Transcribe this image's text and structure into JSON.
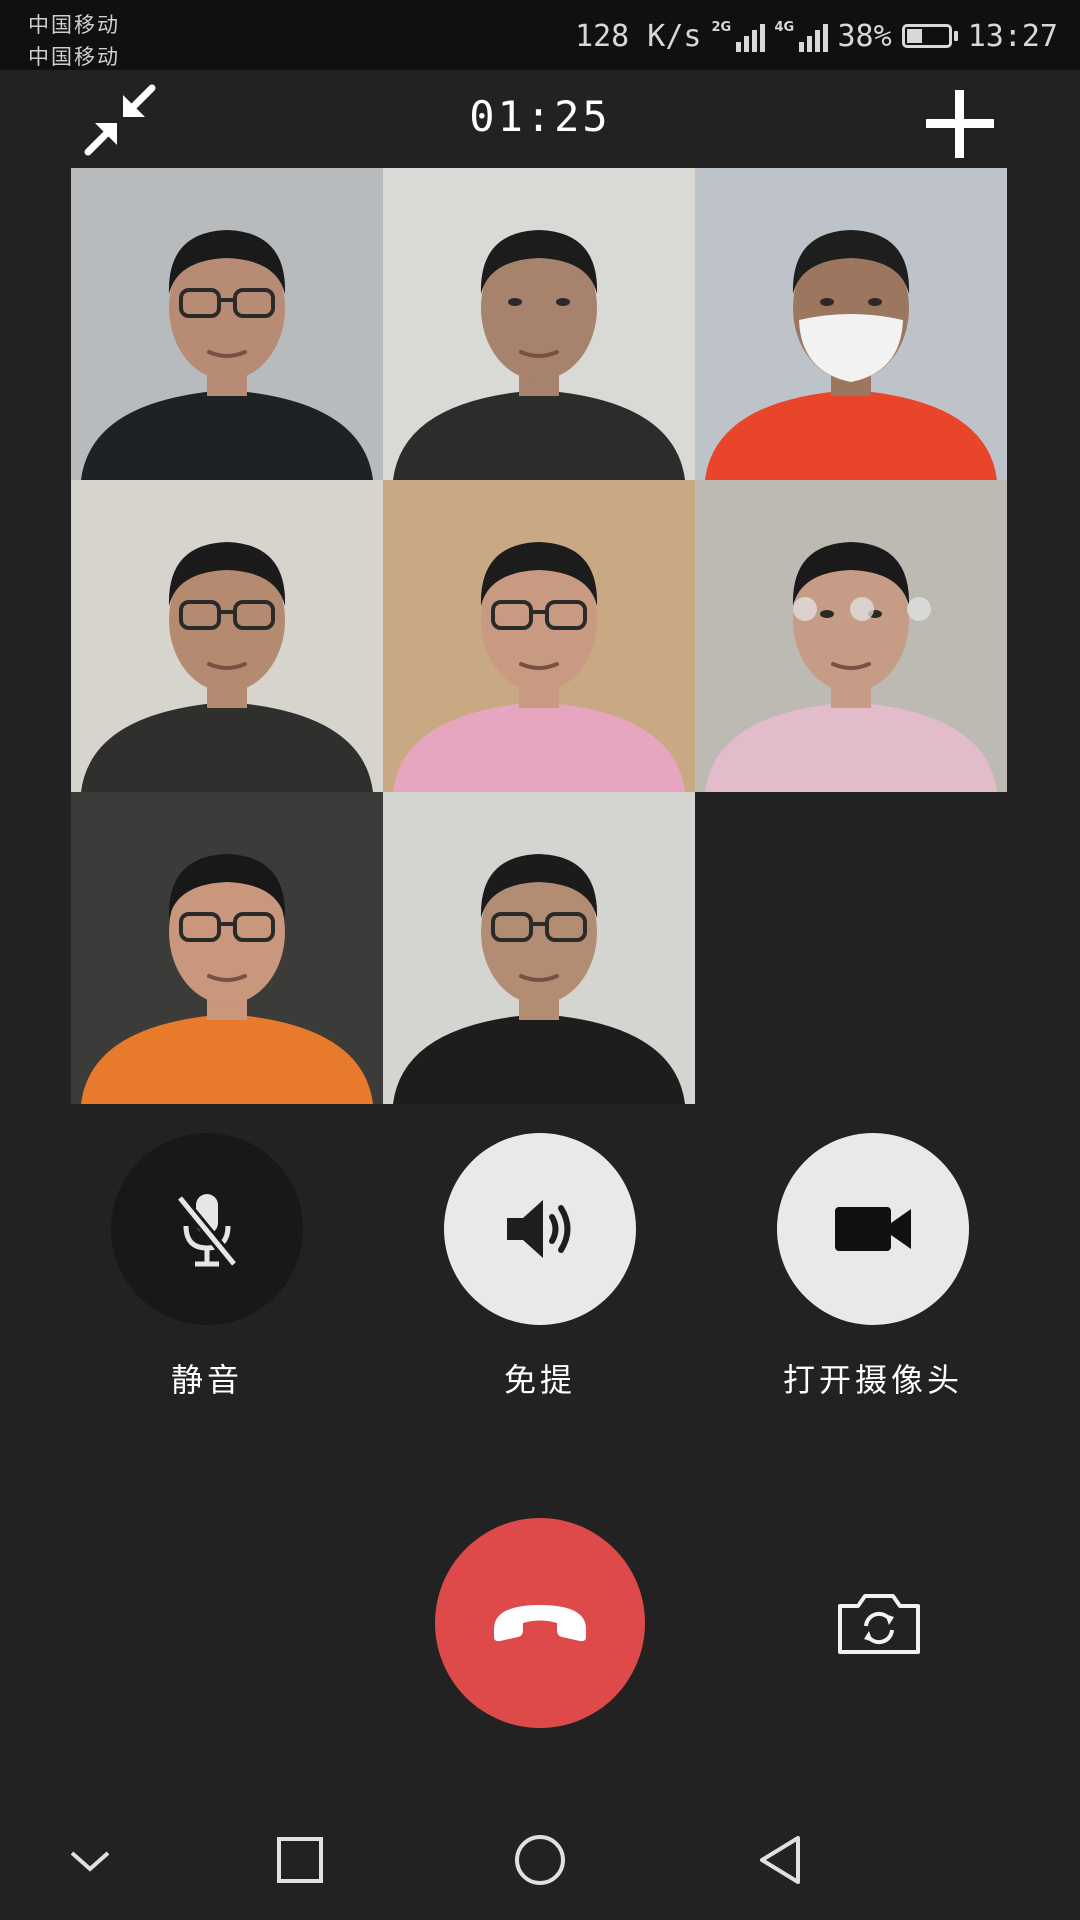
{
  "status_bar": {
    "carrier_1": "中国移动",
    "carrier_2": "中国移动",
    "net_speed": "128 K/s",
    "signal_1_tag": "2G",
    "signal_2_tag": "4G",
    "battery_percent": "38%",
    "battery_level": 0.38,
    "time": "13:27"
  },
  "call": {
    "duration": "01:25",
    "participant_count": 8
  },
  "participants": [
    {
      "bg": "#b7bbbe",
      "skin": "#b88c74",
      "shirt": "#1f2225",
      "hair": "#1a1a1a",
      "glasses": true,
      "mask": false
    },
    {
      "bg": "#d9d9d5",
      "skin": "#a7826d",
      "shirt": "#2a2d2c",
      "hair": "#1c1c1c",
      "glasses": false,
      "mask": false
    },
    {
      "bg": "#bdc3c8",
      "skin": "#9d7660",
      "shirt": "#e8452a",
      "hair": "#1e1e1e",
      "glasses": false,
      "mask": true
    },
    {
      "bg": "#d6d4cd",
      "skin": "#b48a70",
      "shirt": "#2f2f2d",
      "hair": "#1b1b1b",
      "glasses": true,
      "mask": false
    },
    {
      "bg": "#c9a984",
      "skin": "#c99a82",
      "shirt": "#e7a6c0",
      "hair": "#1c1c1c",
      "glasses": true,
      "mask": false
    },
    {
      "bg": "#bcbab2",
      "skin": "#c69c86",
      "shirt": "#e2bccb",
      "hair": "#1a1a1a",
      "glasses": false,
      "mask": false,
      "loading": true
    },
    {
      "bg": "#3b3b3a",
      "skin": "#c9977c",
      "shirt": "#e77a2b",
      "hair": "#181818",
      "glasses": true,
      "mask": false
    },
    {
      "bg": "#d4d4d0",
      "skin": "#b38c74",
      "shirt": "#1d1d1d",
      "hair": "#1b1b1b",
      "glasses": true,
      "mask": false
    }
  ],
  "controls": {
    "mute_label": "静音",
    "speaker_label": "免提",
    "camera_label": "打开摄像头"
  },
  "icons": {
    "minimize": "minimize-arrows-icon",
    "add": "plus-icon",
    "mute": "mic-off-icon",
    "speaker": "speaker-icon",
    "camera": "video-camera-icon",
    "hangup": "phone-hangup-icon",
    "switch_camera": "switch-camera-icon"
  },
  "colors": {
    "background": "#222222",
    "hangup": "#de4a4a",
    "button_light": "#e9e9e9",
    "button_dark": "#181818"
  }
}
